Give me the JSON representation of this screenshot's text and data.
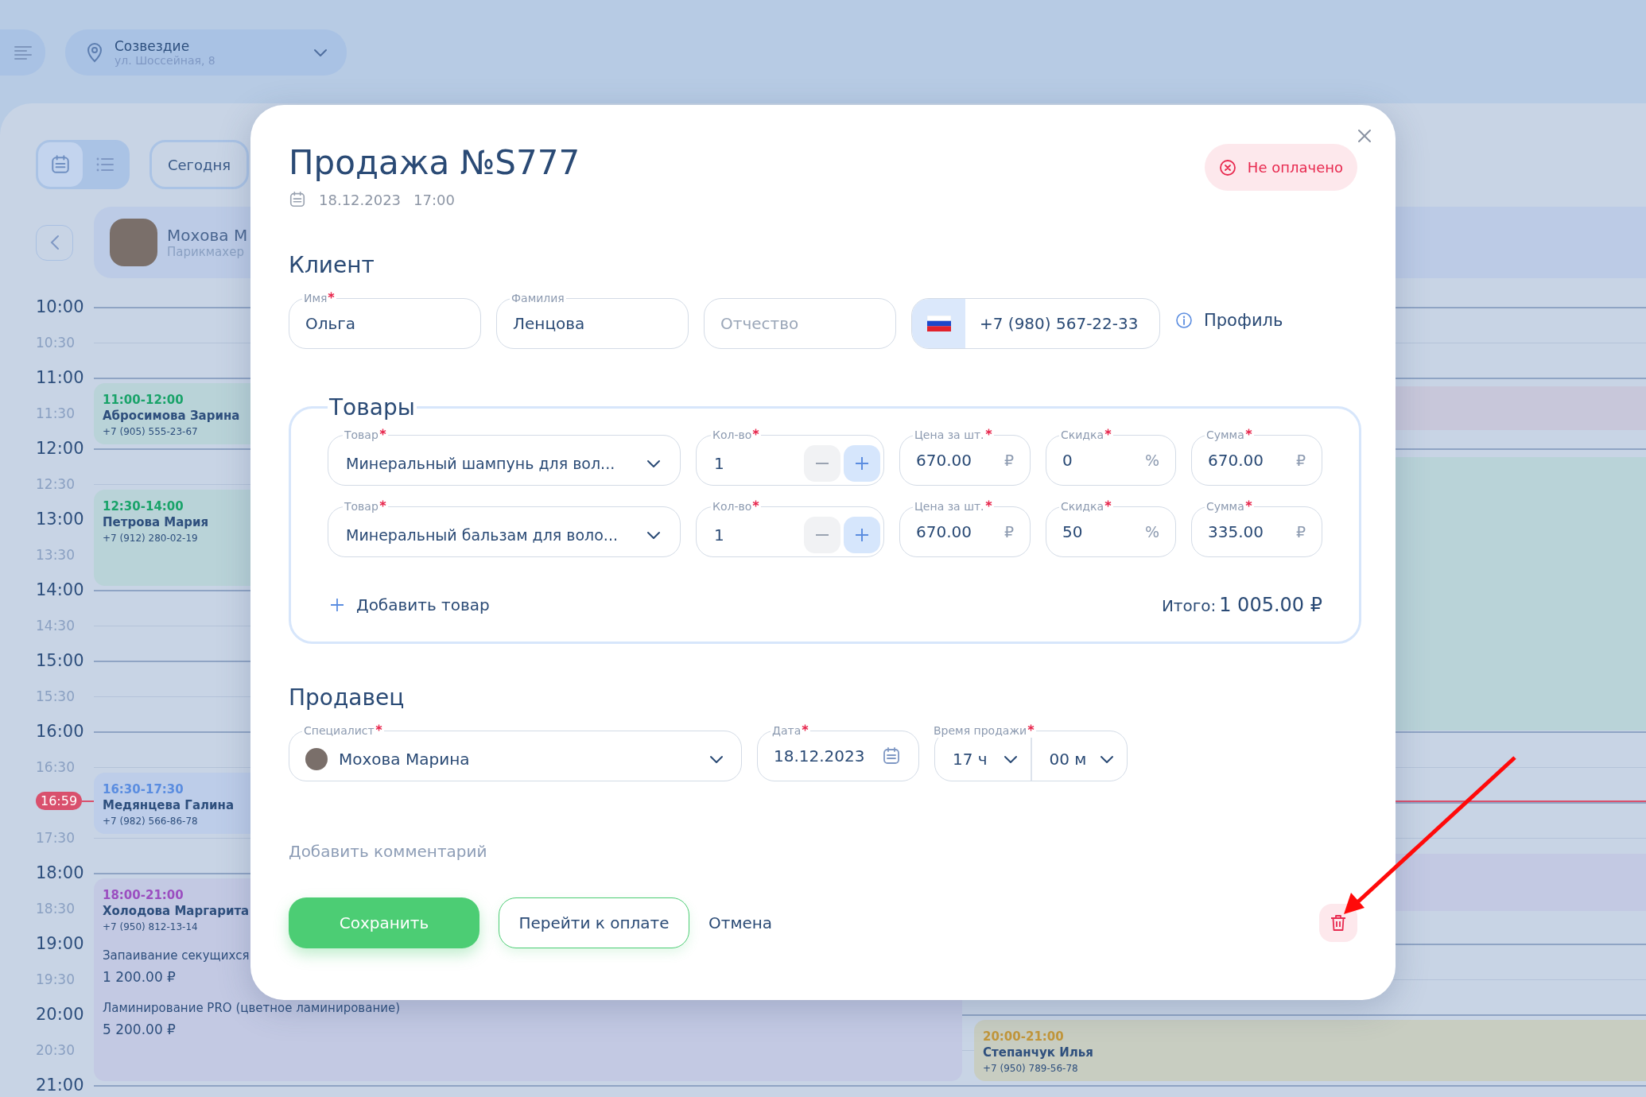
{
  "topbar": {
    "location": {
      "name": "Созвездие",
      "address": "ул. Шоссейная, 8"
    }
  },
  "toolbar": {
    "view_toggle": [
      {
        "kind": "calendar",
        "selected": true
      },
      {
        "kind": "list",
        "selected": false
      }
    ],
    "today_button": "Сегодня"
  },
  "specialist_card": {
    "name": "Мохова М",
    "role": "Парикмахер"
  },
  "schedule": {
    "times": [
      "10:00",
      "10:30",
      "11:00",
      "11:30",
      "12:00",
      "12:30",
      "13:00",
      "13:30",
      "14:00",
      "14:30",
      "15:00",
      "15:30",
      "16:00",
      "16:30",
      "17:30",
      "18:00",
      "18:30",
      "19:00",
      "19:30",
      "20:00",
      "20:30",
      "21:00"
    ],
    "now_marker": "16:59",
    "events": [
      {
        "time": "11:00-12:00",
        "client": "Абросимова Зарина",
        "phone": "+7 (905) 555-23-67",
        "color": "#1aa36a"
      },
      {
        "time": "12:30-14:00",
        "client": "Петрова Мария",
        "phone": "+7 (912) 280-02-19",
        "color": "#1aa36a"
      },
      {
        "time": "16:30-17:30",
        "client": "Медянцева Галина",
        "phone": "+7 (982) 566-86-78",
        "color": "#5b8de0"
      },
      {
        "time": "18:00-21:00",
        "client": "Холодова Маргарита",
        "phone": "+7 (950) 812-13-14",
        "color": "#9b4fc0",
        "services": [
          {
            "name": "Запаивание секущихся",
            "price": "1 200.00 ₽"
          },
          {
            "name": "Ламинирование PRO (цветное ламинирование)",
            "price": "5 200.00 ₽"
          }
        ]
      },
      {
        "time": "20:00-21:00",
        "client": "Степанчук Илья",
        "phone": "+7 (950) 789-56-78",
        "color": "#c2963a"
      }
    ]
  },
  "sale_dialog": {
    "title": "Продажа №S777",
    "date": "18.12.2023",
    "time": "17:00",
    "payment_status": {
      "label": "Не оплачено",
      "paid": false
    },
    "client": {
      "heading": "Клиент",
      "fields": [
        {
          "label": "Имя",
          "required": true,
          "value": "Ольга"
        },
        {
          "label": "Фамилия",
          "required": false,
          "value": "Ленцова"
        },
        {
          "placeholder": "Отчество"
        }
      ],
      "phone": "+7 (980) 567-22-33",
      "profile_link": "Профиль"
    },
    "products": {
      "heading": "Товары",
      "rows": [
        {
          "product": {
            "label": "Товар",
            "value": "Минеральный шампунь для вол..."
          },
          "quantity": {
            "label": "Кол-во",
            "value": "1"
          },
          "price": {
            "label": "Цена за шт.",
            "value": "670.00",
            "unit": "₽"
          },
          "discount": {
            "label": "Скидка",
            "value": "0",
            "unit": "%"
          },
          "sum": {
            "label": "Сумма",
            "value": "670.00",
            "unit": "₽"
          }
        },
        {
          "product": {
            "label": "Товар",
            "value": "Минеральный бальзам для воло..."
          },
          "quantity": {
            "label": "Кол-во",
            "value": "1"
          },
          "price": {
            "label": "Цена за шт.",
            "value": "670.00",
            "unit": "₽"
          },
          "discount": {
            "label": "Скидка",
            "value": "50",
            "unit": "%"
          },
          "sum": {
            "label": "Сумма",
            "value": "335.00",
            "unit": "₽"
          }
        }
      ],
      "add_button": "Добавить товар",
      "total_label": "Итого:",
      "total": "1 005.00 ₽"
    },
    "seller": {
      "heading": "Продавец",
      "specialist": {
        "label": "Специалист",
        "value": "Мохова Марина"
      },
      "date": {
        "label": "Дата",
        "value": "18.12.2023"
      },
      "time": {
        "label": "Время продажи",
        "hours": "17 ч",
        "minutes": "00 м"
      }
    },
    "comment_placeholder": "Добавить комментарий",
    "buttons": {
      "save": "Сохранить",
      "pay": "Перейти к оплате",
      "cancel": "Отмена"
    }
  },
  "annotations": [
    {
      "kind": "arrow"
    }
  ]
}
